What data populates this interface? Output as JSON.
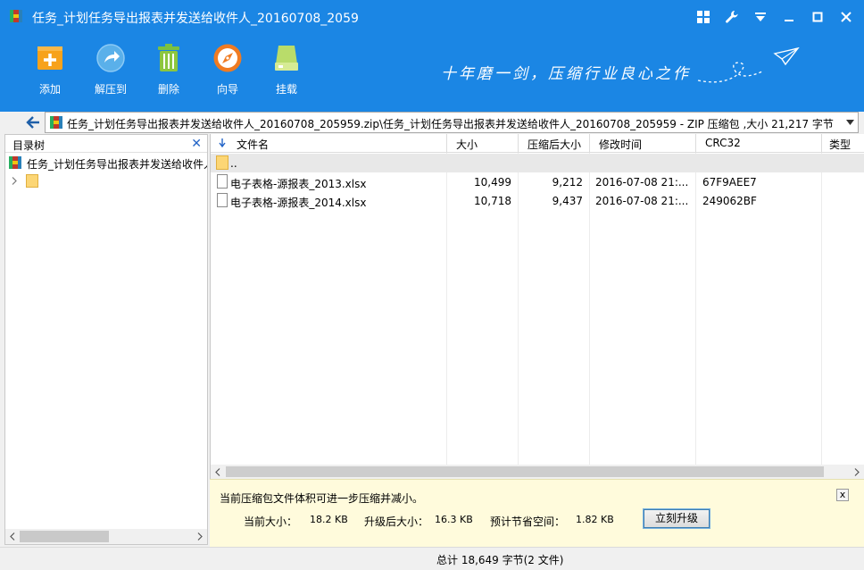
{
  "window": {
    "title": "任务_计划任务导出报表并发送给收件人_20160708_2059"
  },
  "toolbar": {
    "buttons": [
      {
        "label": "添加",
        "icon": "add-icon"
      },
      {
        "label": "解压到",
        "icon": "extract-icon"
      },
      {
        "label": "删除",
        "icon": "trash-icon"
      },
      {
        "label": "向导",
        "icon": "compass-icon"
      },
      {
        "label": "挂载",
        "icon": "drive-icon"
      }
    ],
    "slogan": "十年磨一剑，压缩行业良心之作"
  },
  "address": {
    "path": "任务_计划任务导出报表并发送给收件人_20160708_205959.zip\\任务_计划任务导出报表并发送给收件人_20160708_205959 - ZIP 压缩包 ,大小 21,217 字节"
  },
  "tree": {
    "header": "目录树",
    "root_label": "任务_计划任务导出报表并发送给收件人_"
  },
  "list": {
    "columns": [
      "文件名",
      "大小",
      "压缩后大小",
      "修改时间",
      "CRC32",
      "类型"
    ],
    "up_label": "..",
    "rows": [
      {
        "name": "电子表格-源报表_2013.xlsx",
        "size": "10,499",
        "packed": "9,212",
        "modified": "2016-07-08   21:...",
        "crc": "67F9AEE7"
      },
      {
        "name": "电子表格-源报表_2014.xlsx",
        "size": "10,718",
        "packed": "9,437",
        "modified": "2016-07-08   21:...",
        "crc": "249062BF"
      }
    ]
  },
  "banner": {
    "message": "当前压缩包文件体积可进一步压缩并减小。",
    "close": "x",
    "current_label": "当前大小：",
    "current_value": "18.2 KB",
    "after_label": "升级后大小：",
    "after_value": "16.3 KB",
    "saved_label": "预计节省空间：",
    "saved_value": "1.82 KB",
    "upgrade_button": "立刻升级"
  },
  "status": {
    "text": "总计  18,649 字节(2 文件)"
  },
  "colors": {
    "titlebar": "#1b86e4",
    "banner_bg": "#fffbdc"
  }
}
